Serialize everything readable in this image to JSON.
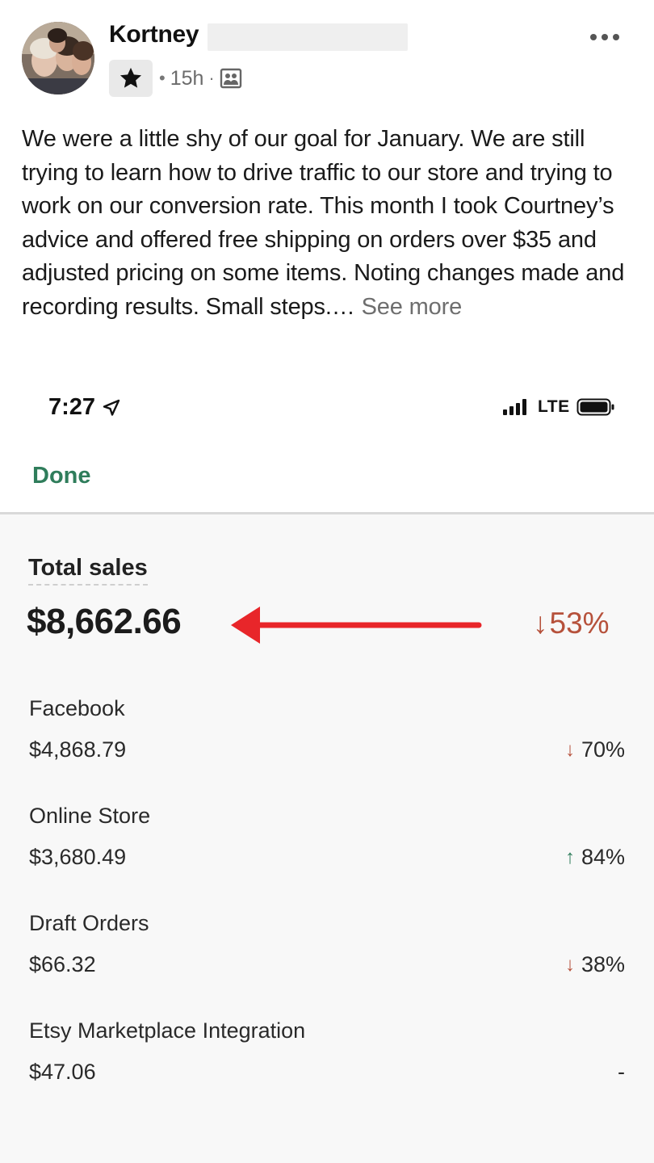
{
  "post": {
    "author_first_name": "Kortney",
    "time_ago": "15h",
    "body_text": "We were a little shy of our goal for January. We are still trying to learn how to drive traffic to our store and trying to work on our conversion rate. This month I took Courtney’s advice and offered free shipping on orders over $35 and adjusted pricing on some items. Noting changes made and recording results. Small steps.…",
    "see_more_label": "See more",
    "icons": {
      "badge": "star-icon",
      "audience": "group-icon",
      "options": "more-options-icon"
    }
  },
  "phone_status": {
    "time": "7:27",
    "network": "LTE"
  },
  "sales_screen": {
    "done_label": "Done",
    "total_sales_label": "Total sales",
    "total_sales_value": "$8,662.66",
    "total_change_arrow": "↓",
    "total_change_value": "53%",
    "channels": [
      {
        "name": "Facebook",
        "amount": "$4,868.79",
        "direction": "down",
        "arrow": "↓",
        "change": "70%"
      },
      {
        "name": "Online Store",
        "amount": "$3,680.49",
        "direction": "up",
        "arrow": "↑",
        "change": "84%"
      },
      {
        "name": "Draft Orders",
        "amount": "$66.32",
        "direction": "down",
        "arrow": "↓",
        "change": "38%"
      },
      {
        "name": "Etsy Marketplace Integration",
        "amount": "$47.06",
        "direction": "none",
        "arrow": "",
        "change": "-"
      }
    ]
  },
  "colors": {
    "done_green": "#2f7d5b",
    "decrease_red": "#b6513b",
    "increase_green": "#2f7d5b",
    "annotation_arrow_red": "#e8262a"
  }
}
